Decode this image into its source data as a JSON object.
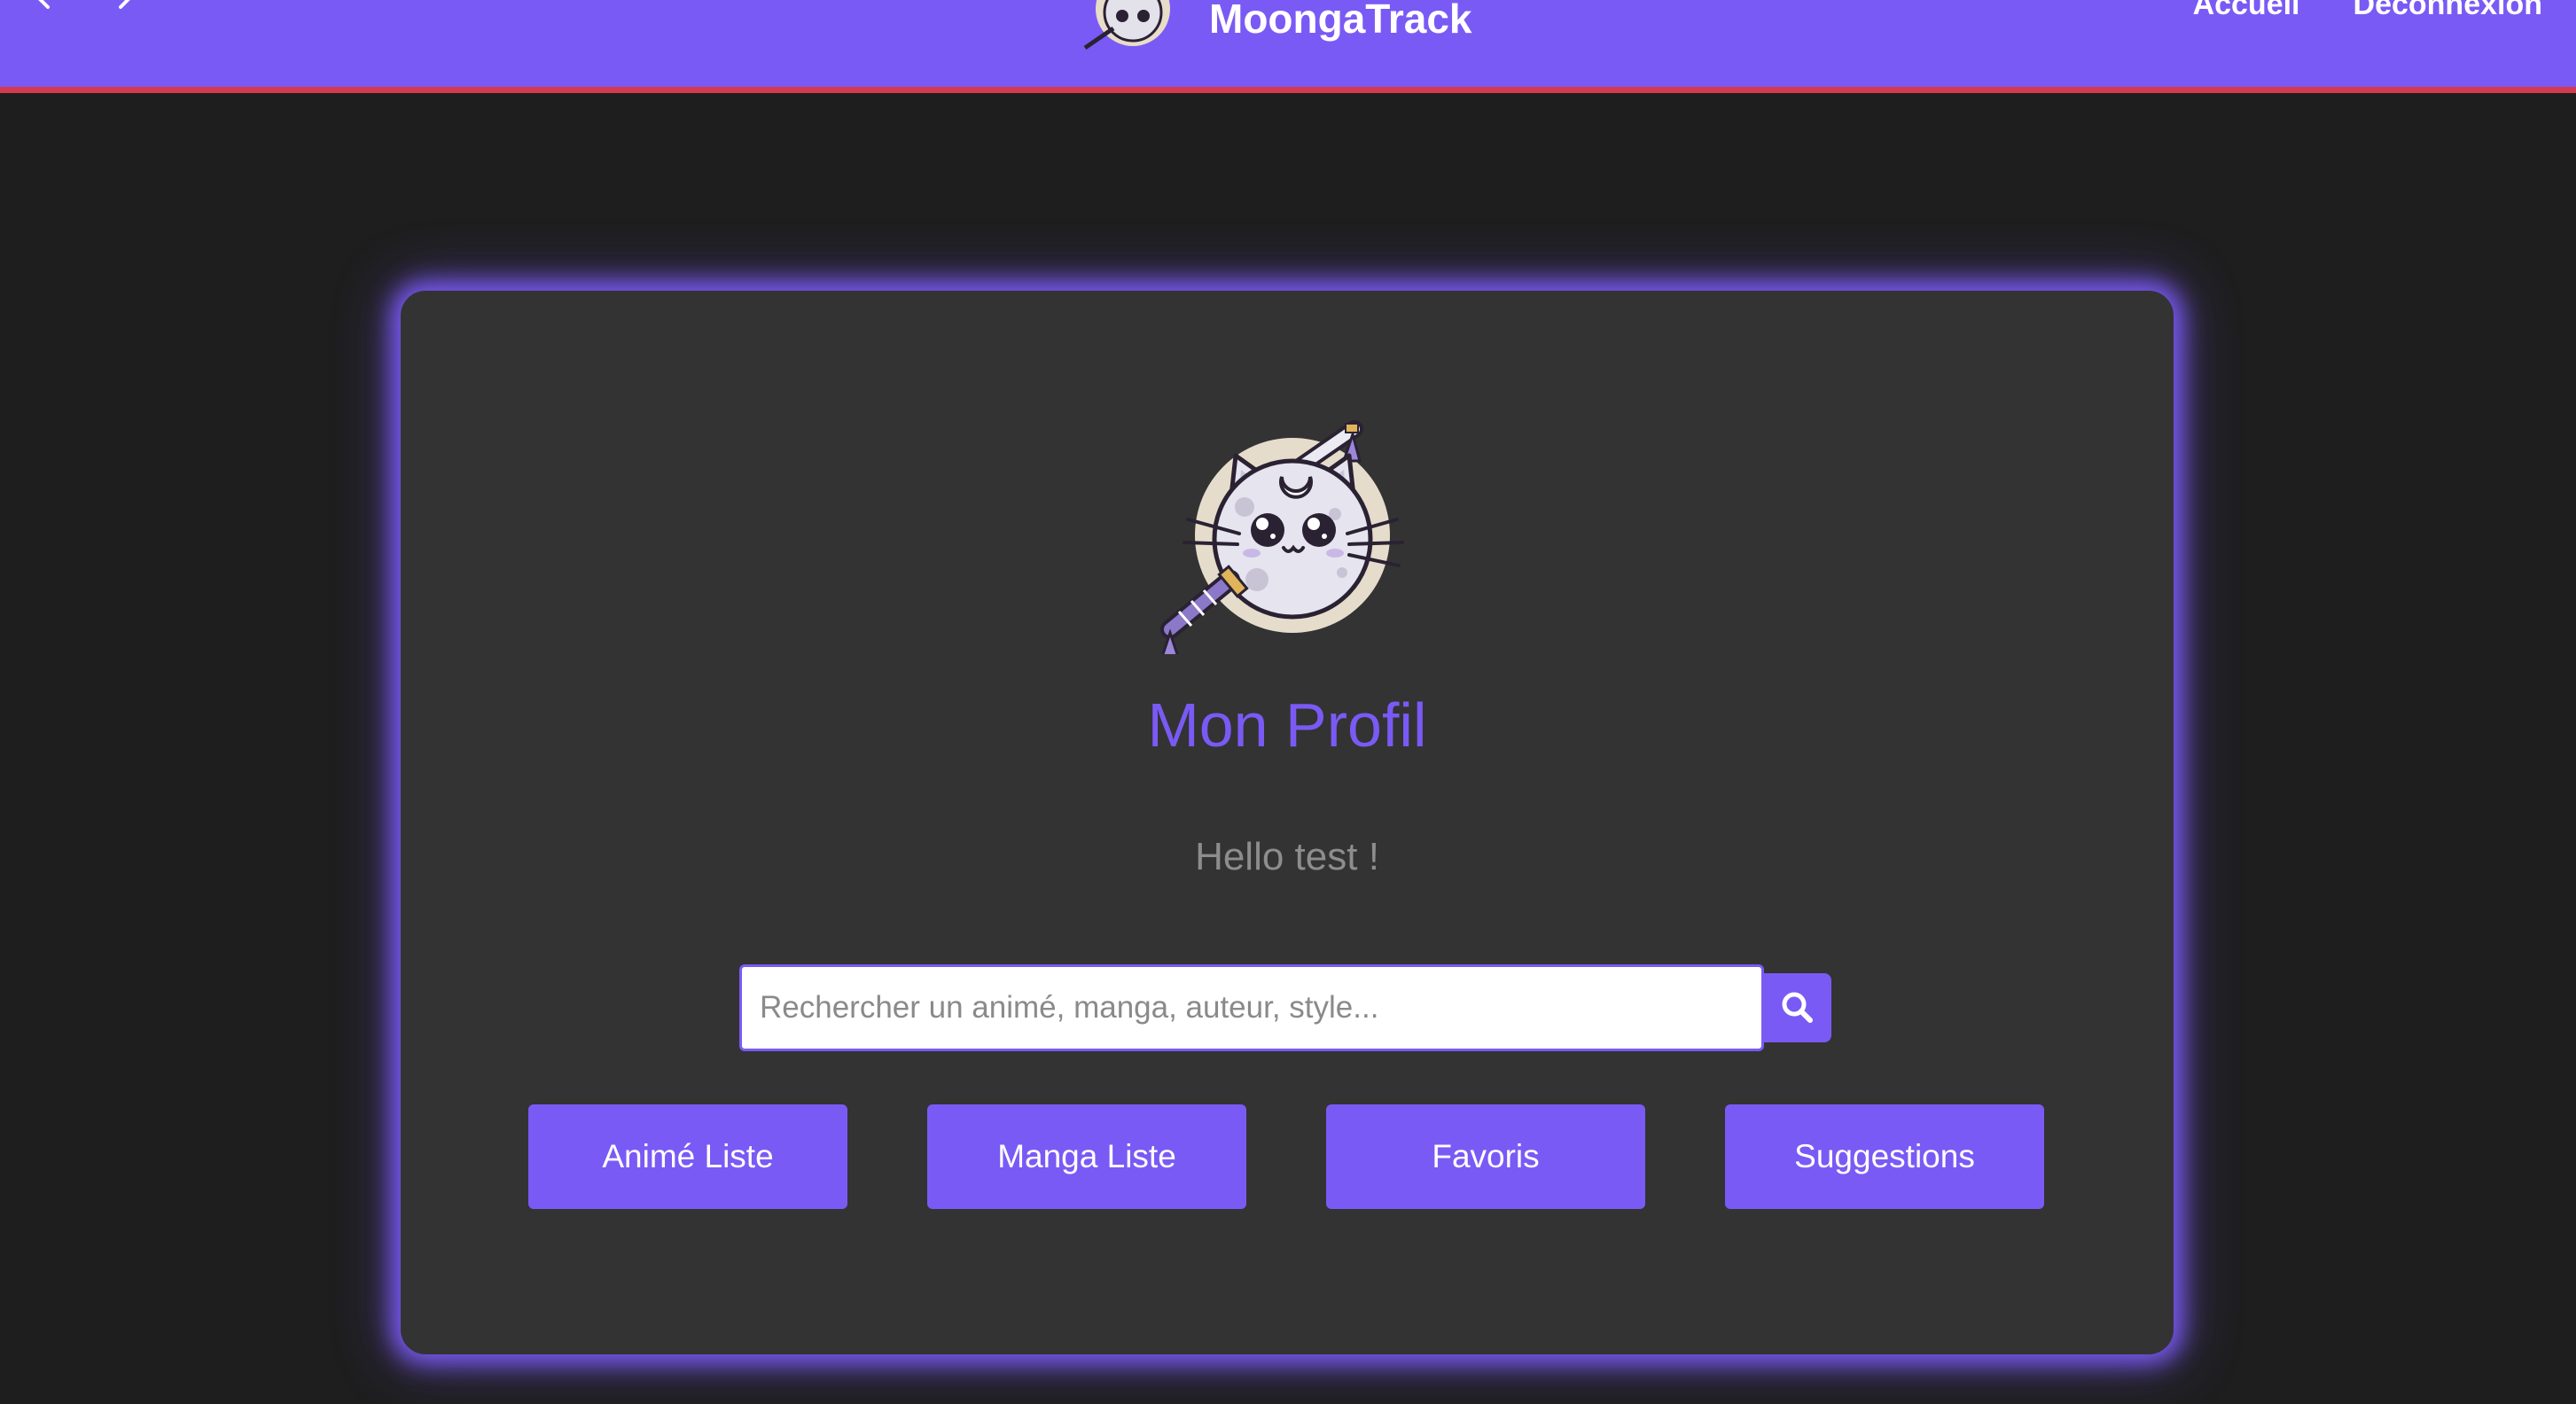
{
  "header": {
    "brand": "MoongaTrack",
    "links": [
      "Accueil",
      "Déconnexion"
    ],
    "back_icon": "arrow-left-icon",
    "forward_icon": "arrow-right-icon",
    "logo_icon": "moon-cat-samurai-logo"
  },
  "profile": {
    "title": "Mon Profil",
    "greeting": "Hello test !",
    "avatar_icon": "moon-cat-samurai-avatar"
  },
  "search": {
    "placeholder": "Rechercher un animé, manga, auteur, style...",
    "value": "",
    "button_icon": "search-icon"
  },
  "actions": [
    "Animé Liste",
    "Manga Liste",
    "Favoris",
    "Suggestions"
  ],
  "colors": {
    "accent": "#7a5af5",
    "header_border": "#d63a4e",
    "background": "#1e1e1e",
    "card": "#333333",
    "greeting": "#8d8d8d"
  }
}
